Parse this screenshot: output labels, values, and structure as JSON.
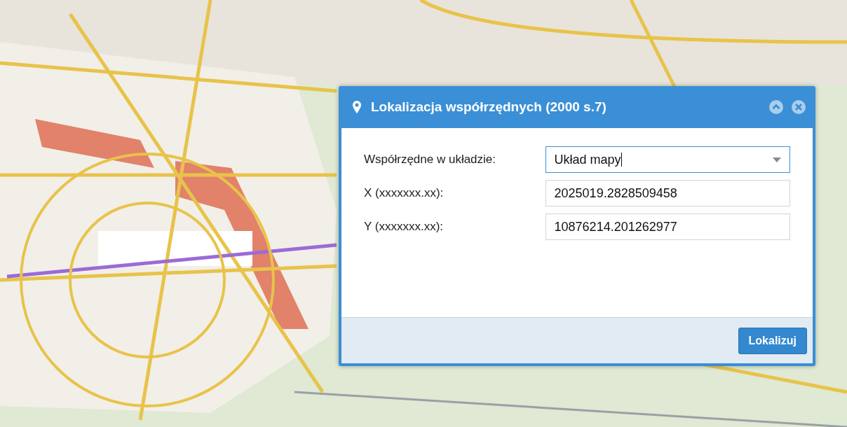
{
  "dialog": {
    "title": "Lokalizacja współrzędnych (2000 s.7)",
    "rows": [
      {
        "kind": "select",
        "label": "Współrzędne w układzie:",
        "value": "Układ mapy"
      },
      {
        "kind": "text",
        "label": "X (xxxxxxx.xx):",
        "value": "2025019.2828509458"
      },
      {
        "kind": "text",
        "label": "Y (xxxxxxx.xx):",
        "value": "10876214.201262977"
      }
    ],
    "button": "Lokalizuj"
  }
}
